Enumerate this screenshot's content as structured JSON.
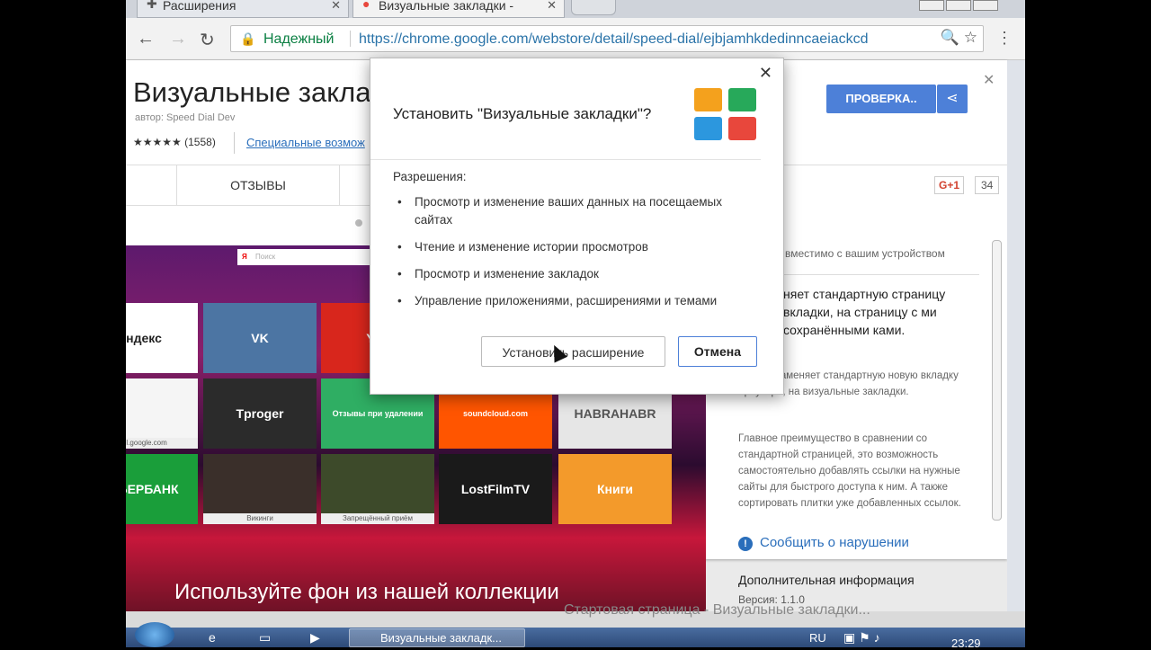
{
  "browser": {
    "tabs": [
      {
        "label": "Расширения",
        "icon": "puzzle-icon"
      },
      {
        "label": "Визуальные закладки - ",
        "icon": "chrome-store-icon"
      }
    ],
    "address": {
      "secure_label": "Надежный",
      "url": "https://chrome.google.com/webstore/detail/speed-dial/ejbjamhkdedinncaeiackcd"
    }
  },
  "listing": {
    "title": "Визуальные закладки",
    "author": "автор: Speed Dial Dev",
    "stars": "★★★★★",
    "rating_count": "(1558)",
    "accessibility_link": "Специальные возмож",
    "check_button": "ПРОВЕРКА..",
    "reviews_tab": "ОТЗЫВЫ",
    "gplus_label": "G+1",
    "gplus_count": "34",
    "compatibility": "вместимо с вашим устройством",
    "bold_desc": "няет стандартную страницу вкладки, на страницу с ми сохранёнными ками.",
    "desc_1": "ирение заменяет стандартную новую вкладку браузера, на визуальные закладки.",
    "desc_2": "Главное преимущество в сравнении со стандартной страницей, это возможность самостоятельно добавлять ссылки на нужные сайты для быстрого доступа к ним. А также сортировать плитки уже добавленных ссылок.",
    "report_link": "Сообщить о нарушении",
    "more_info": "Дополнительная информация",
    "version": "Версия: 1.1.0"
  },
  "preview": {
    "search_placeholder": "Поиск",
    "search_brand": "Я",
    "tiles": [
      {
        "label": "ндекс",
        "bg": "#ffffff",
        "fg": "#222222"
      },
      {
        "label": "VK",
        "bg": "#4c75a3",
        "fg": "#ffffff"
      },
      {
        "label": "You",
        "bg": "#d8261c",
        "fg": "#ffffff"
      },
      {
        "label": "",
        "bg": "#f5f5f5",
        "fg": "#333333",
        "cap": "ail.google.com"
      },
      {
        "label": "Tproger",
        "bg": "#2b2b2b",
        "fg": "#ffffff"
      },
      {
        "label": "Отзывы при удалении",
        "bg": "#2fae63",
        "fg": "#ffffff"
      },
      {
        "label": "soundcloud.com",
        "bg": "#ff5500",
        "fg": "#ffffff"
      },
      {
        "label": "HABRAHABR",
        "bg": "#e6e6e6",
        "fg": "#555555"
      },
      {
        "label": "СБЕРБАНК",
        "bg": "#1a9e3a",
        "fg": "#ffffff"
      },
      {
        "label": "",
        "bg": "#3a2f2a",
        "fg": "#ffffff",
        "cap": "Викинги"
      },
      {
        "label": "",
        "bg": "#3d4a2a",
        "fg": "#ffffff",
        "cap": "Запрещённый приём"
      },
      {
        "label": "LostFilmTV",
        "bg": "#1a1a1a",
        "fg": "#ffffff"
      },
      {
        "label": "Книги",
        "bg": "#f39a2b",
        "fg": "#ffffff"
      }
    ],
    "caption": "Используйте фон из нашей коллекции"
  },
  "dialog": {
    "title": "Установить \"Визуальные закладки\"?",
    "permissions_heading": "Разрешения:",
    "permissions": [
      "Просмотр и изменение ваших данных на посещаемых сайтах",
      "Чтение и изменение истории просмотров",
      "Просмотр и изменение закладок",
      "Управление приложениями, расширениями и темами"
    ],
    "install_button": "Установить расширение",
    "cancel_button": "Отмена",
    "logo_colors": [
      "#f4a11d",
      "#27a95a",
      "#2c97de",
      "#e8473c"
    ]
  },
  "bottom_text": "Стартовая страница - Визуальные закладки...",
  "taskbar": {
    "task_label": "Визуальные закладк...",
    "lang": "RU",
    "clock": "23:29"
  }
}
